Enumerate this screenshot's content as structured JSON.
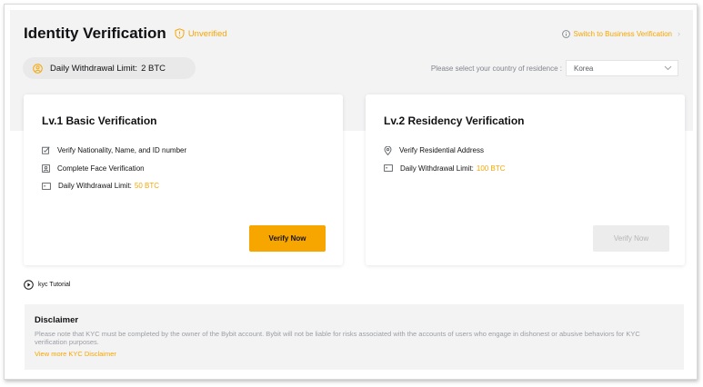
{
  "header": {
    "title": "Identity Verification",
    "status": "Unverified",
    "switch_link": "Switch to Business Verification"
  },
  "limit": {
    "label": "Daily Withdrawal Limit:",
    "value": "2 BTC"
  },
  "country": {
    "label": "Please select your country of residence :",
    "selected": "Korea"
  },
  "cards": [
    {
      "title": "Lv.1 Basic Verification",
      "items": [
        {
          "icon": "id-check-icon",
          "text": "Verify Nationality, Name, and ID number"
        },
        {
          "icon": "face-id-icon",
          "text": "Complete Face Verification"
        },
        {
          "icon": "wallet-icon",
          "text": "Daily Withdrawal Limit:",
          "highlight": "50 BTC"
        }
      ],
      "button": "Verify Now",
      "button_state": "enabled"
    },
    {
      "title": "Lv.2 Residency Verification",
      "items": [
        {
          "icon": "location-pin-icon",
          "text": "Verify Residential Address"
        },
        {
          "icon": "wallet-icon",
          "text": "Daily Withdrawal Limit:",
          "highlight": "100 BTC"
        }
      ],
      "button": "Verify Now",
      "button_state": "disabled"
    }
  ],
  "tutorial": {
    "icon": "play-circle-icon",
    "label": "kyc Tutorial"
  },
  "disclaimer": {
    "title": "Disclaimer",
    "text": "Please note that KYC must be completed by the owner of the Bybit account. Bybit will not be liable for risks associated with the accounts of users who engage in dishonest or abusive behaviors for KYC verification purposes.",
    "link": "View more KYC Disclaimer"
  },
  "colors": {
    "accent": "#f7a600",
    "band": "#f3f3f4",
    "muted_text": "#9a9ea3",
    "disabled_button": "#ececec"
  }
}
